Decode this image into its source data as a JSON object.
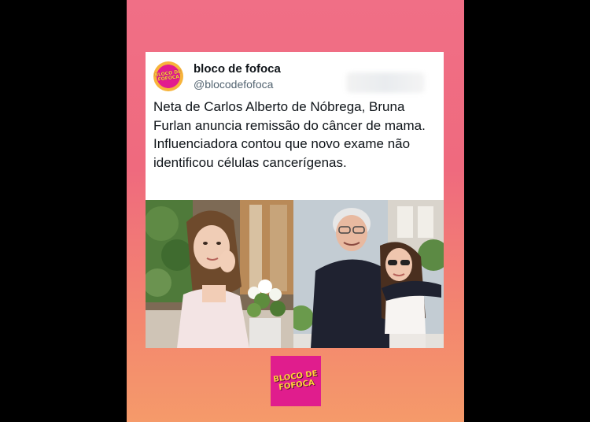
{
  "post": {
    "author_name": "bloco de fofoca",
    "author_handle": "@blocodefofoca",
    "avatar_text": "BLOCO DE\nFOFOCA",
    "text": "Neta de Carlos Alberto de Nóbrega, Bruna Furlan anuncia remissão do câncer de mama. Influenciadora contou que novo exame não identificou células cancerígenas.",
    "photo_icons": [
      "young-woman-with-flowers-photo",
      "elderly-man-with-woman-photo"
    ]
  },
  "footer": {
    "logo_text": "BLOCO DE\nFOFOCA"
  },
  "colors": {
    "background_top": "#f06f86",
    "background_bottom": "#f59a6a",
    "brand_pink": "#e01d8d",
    "brand_yellow": "#ffd23a"
  }
}
